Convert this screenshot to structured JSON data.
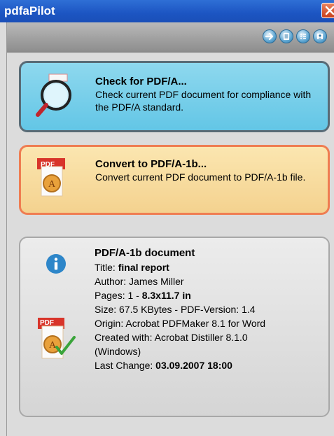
{
  "window": {
    "title": "pdfaPilot"
  },
  "toolbar": {
    "buttons": [
      "arrow-right-icon",
      "list-icon",
      "details-list-icon",
      "profile-icon"
    ]
  },
  "check": {
    "title": "Check for PDF/A...",
    "description": "Check current PDF document for compliance with the PDF/A standard."
  },
  "convert": {
    "title": "Convert to PDF/A-1b...",
    "description": "Convert current PDF document to PDF/A-1b file.",
    "pdf_badge": "PDF"
  },
  "document": {
    "heading": "PDF/A-1b document",
    "title_label": "Title: ",
    "title_value": "final report",
    "author": "Author: James Miller",
    "pages_label": "Pages: 1 - ",
    "pages_value": "8.3x11.7 in",
    "size": "Size: 67.5 KBytes - PDF-Version: 1.4",
    "origin": "Origin: Acrobat PDFMaker 8.1 for Word",
    "created_with_1": "Created with: Acrobat Distiller 8.1.0",
    "created_with_2": "(Windows)",
    "last_change_label": "Last Change: ",
    "last_change_value": "03.09.2007 18:00",
    "pdf_badge": "PDF"
  },
  "colors": {
    "title_bar": "#1c55c2",
    "check_card": "#63c6e6",
    "convert_card": "#f4d28f",
    "convert_border": "#ef7d52",
    "info_card": "#e0e0e0"
  }
}
